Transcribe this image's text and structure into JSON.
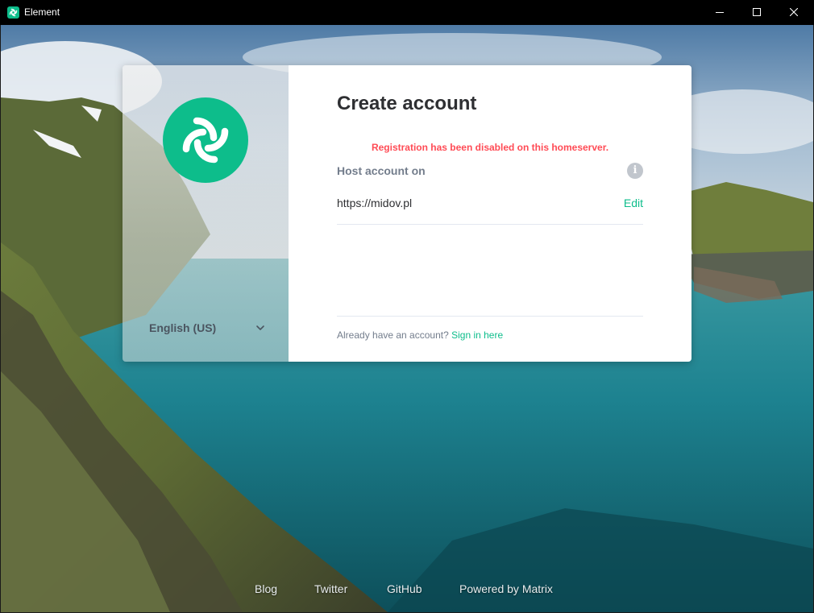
{
  "window": {
    "title": "Element",
    "controls": [
      "minimize",
      "maximize",
      "close"
    ]
  },
  "language": {
    "selected": "English (US)"
  },
  "auth": {
    "title": "Create account",
    "error": "Registration has been disabled on this homeserver.",
    "host_label": "Host account on",
    "server_url": "https://midov.pl",
    "edit_label": "Edit",
    "signin_prompt": "Already have an account?",
    "signin_link": "Sign in here"
  },
  "footer": {
    "links": [
      "Blog",
      "Twitter",
      "GitHub",
      "Powered by Matrix"
    ]
  },
  "colors": {
    "accent": "#0dbd8b",
    "error": "#ff4b55",
    "titlebar": "#000000"
  },
  "icons": {
    "app": "element-logo-icon",
    "info": "info-icon",
    "language": "chevron-down-icon"
  }
}
